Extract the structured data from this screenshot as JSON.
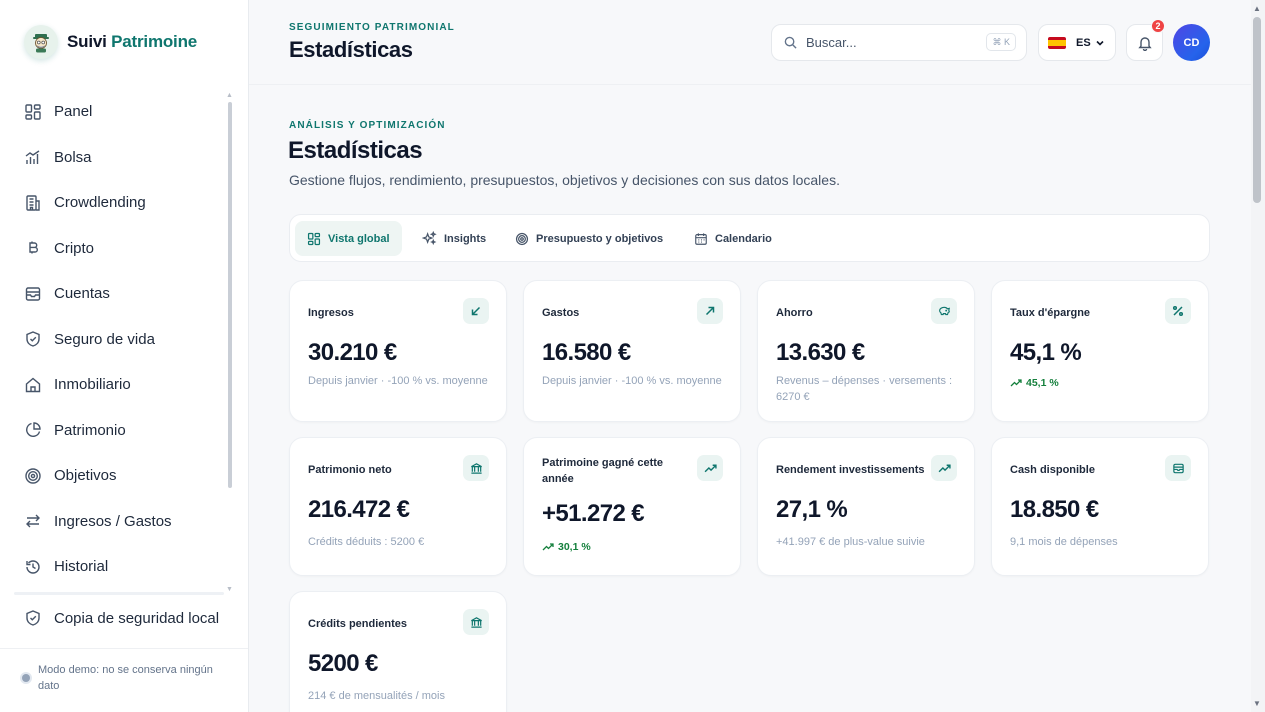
{
  "brand": {
    "name_part1": "Suivi",
    "name_part2": "Patrimoine"
  },
  "sidebar": {
    "items": [
      {
        "label": "Panel",
        "icon": "grid-icon"
      },
      {
        "label": "Bolsa",
        "icon": "bar-chart-icon"
      },
      {
        "label": "Crowdlending",
        "icon": "building-icon"
      },
      {
        "label": "Cripto",
        "icon": "bitcoin-icon"
      },
      {
        "label": "Cuentas",
        "icon": "inbox-icon"
      },
      {
        "label": "Seguro de vida",
        "icon": "shield-icon"
      },
      {
        "label": "Inmobiliario",
        "icon": "home-icon"
      },
      {
        "label": "Patrimonio",
        "icon": "pie-chart-icon"
      },
      {
        "label": "Objetivos",
        "icon": "target-icon"
      },
      {
        "label": "Ingresos / Gastos",
        "icon": "arrows-swap-icon"
      },
      {
        "label": "Historial",
        "icon": "history-icon"
      }
    ],
    "backup_label": "Copia de seguridad local",
    "demo_text": "Modo demo: no se conserva ningún dato"
  },
  "header": {
    "kicker": "SEGUIMIENTO PATRIMONIAL",
    "title": "Estadísticas",
    "search_placeholder": "Buscar...",
    "search_shortcut": "⌘ K",
    "language": "ES",
    "notification_count": "2",
    "avatar_initials": "CD"
  },
  "main": {
    "kicker": "ANÁLISIS Y OPTIMIZACIÓN",
    "title": "Estadísticas",
    "subtitle": "Gestione flujos, rendimiento, presupuestos, objetivos y decisiones con sus datos locales.",
    "tabs": [
      {
        "label": "Vista global",
        "active": true
      },
      {
        "label": "Insights",
        "active": false
      },
      {
        "label": "Presupuesto y objetivos",
        "active": false
      },
      {
        "label": "Calendario",
        "active": false
      }
    ]
  },
  "cards": [
    {
      "label": "Ingresos",
      "value": "30.210 €",
      "note": "Depuis janvier · -100 % vs. moyenne",
      "icon": "arrow-down-left-icon"
    },
    {
      "label": "Gastos",
      "value": "16.580 €",
      "note": "Depuis janvier · -100 % vs. moyenne",
      "icon": "arrow-up-right-icon"
    },
    {
      "label": "Ahorro",
      "value": "13.630 €",
      "note": "Revenus – dépenses · versements : 6270 €",
      "icon": "piggy-bank-icon"
    },
    {
      "label": "Taux d'épargne",
      "value": "45,1 %",
      "trend": "45,1 %",
      "icon": "percent-icon"
    },
    {
      "label": "Patrimonio neto",
      "value": "216.472 €",
      "note": "Crédits déduits : 5200 €",
      "icon": "bank-icon"
    },
    {
      "label": "Patrimoine gagné cette année",
      "value": "+51.272 €",
      "trend": "30,1 %",
      "icon": "trending-up-icon"
    },
    {
      "label": "Rendement investissements",
      "value": "27,1 %",
      "note": "+41.997 € de plus-value suivie",
      "icon": "trending-up-icon"
    },
    {
      "label": "Cash disponible",
      "value": "18.850 €",
      "note": "9,1 mois de dépenses",
      "icon": "wallet-icon"
    },
    {
      "label": "Crédits pendientes",
      "value": "5200 €",
      "note": "214 € de mensualités / mois",
      "icon": "bank-icon"
    }
  ],
  "colors": {
    "accent": "#0f766e",
    "positive": "#15803d",
    "badge": "#ef4444",
    "avatar": "#4f46e5"
  }
}
